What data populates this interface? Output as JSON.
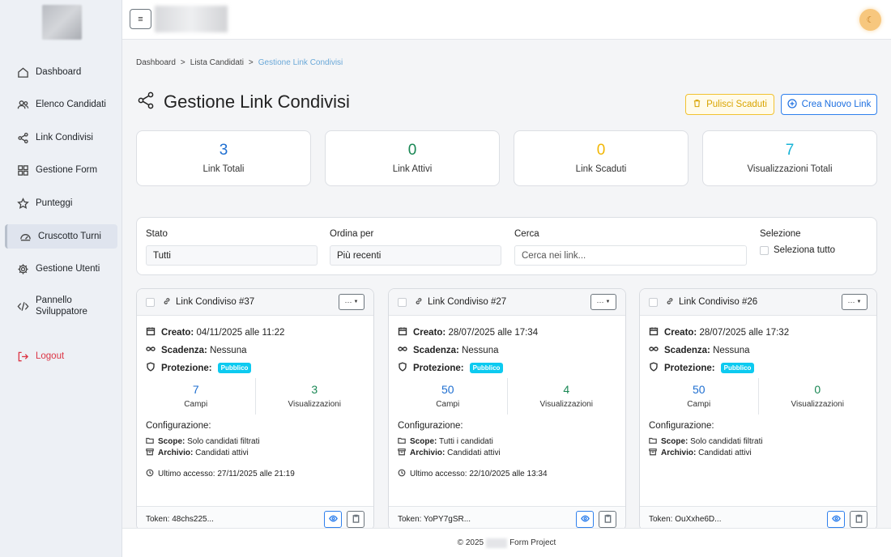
{
  "sidebar": {
    "items": [
      {
        "label": "Dashboard",
        "icon": "home-icon"
      },
      {
        "label": "Elenco Candidati",
        "icon": "users-icon"
      },
      {
        "label": "Link Condivisi",
        "icon": "share-icon"
      },
      {
        "label": "Gestione Form",
        "icon": "grid-icon"
      },
      {
        "label": "Punteggi",
        "icon": "star-icon"
      },
      {
        "label": "Cruscotto Turni",
        "icon": "speedometer-icon",
        "active": true
      },
      {
        "label": "Gestione Utenti",
        "icon": "gear-icon"
      },
      {
        "label": "Pannello Sviluppatore",
        "icon": "code-icon"
      }
    ],
    "logout": "Logout"
  },
  "topbar": {
    "menu_glyph": "≡",
    "avatar_glyph": "☾"
  },
  "breadcrumb": {
    "items": [
      "Dashboard",
      "Lista Candidati",
      "Gestione Link Condivisi"
    ],
    "separator": ">"
  },
  "page": {
    "title": "Gestione Link Condivisi",
    "clean_button": "Pulisci Scaduti",
    "create_button": "Crea Nuovo Link"
  },
  "stats": [
    {
      "value": "3",
      "label": "Link Totali",
      "color": "#1f6fd1"
    },
    {
      "value": "0",
      "label": "Link Attivi",
      "color": "#198754"
    },
    {
      "value": "0",
      "label": "Link Scaduti",
      "color": "#f2b705"
    },
    {
      "value": "7",
      "label": "Visualizzazioni Totali",
      "color": "#17b3d6"
    }
  ],
  "filters": {
    "stato_label": "Stato",
    "stato_value": "Tutti",
    "ordina_label": "Ordina per",
    "ordina_value": "Più recenti",
    "cerca_label": "Cerca",
    "cerca_placeholder": "Cerca nei link...",
    "selezione_label": "Selezione",
    "seleziona_tutto": "Seleziona tutto"
  },
  "card_labels": {
    "created": "Creato:",
    "expiry": "Scadenza:",
    "protection": "Protezione:",
    "fields": "Campi",
    "views": "Visualizzazioni",
    "config": "Configurazione:",
    "scope": "Scope:",
    "archive": "Archivio:",
    "dots": "···"
  },
  "cards": [
    {
      "title": "Link Condiviso #37",
      "created": "04/11/2025 alle 11:22",
      "expiry": "Nessuna",
      "protection": "Pubblico",
      "fields": "7",
      "views": "3",
      "scope": "Solo candidati filtrati",
      "archive": "Candidati attivi",
      "last_access": "Ultimo accesso: 27/11/2025 alle 21:19",
      "token": "Token: 48chs225..."
    },
    {
      "title": "Link Condiviso #27",
      "created": "28/07/2025 alle 17:34",
      "expiry": "Nessuna",
      "protection": "Pubblico",
      "fields": "50",
      "views": "4",
      "scope": "Tutti i candidati",
      "archive": "Candidati attivi",
      "last_access": "Ultimo accesso: 22/10/2025 alle 13:34",
      "token": "Token: YoPY7gSR..."
    },
    {
      "title": "Link Condiviso #26",
      "created": "28/07/2025 alle 17:32",
      "expiry": "Nessuna",
      "protection": "Pubblico",
      "fields": "50",
      "views": "0",
      "scope": "Solo candidati filtrati",
      "archive": "Candidati attivi",
      "last_access": "",
      "token": "Token: OuXxhe6D..."
    }
  ],
  "footer": {
    "prefix": "© 2025",
    "suffix": "Form Project"
  }
}
